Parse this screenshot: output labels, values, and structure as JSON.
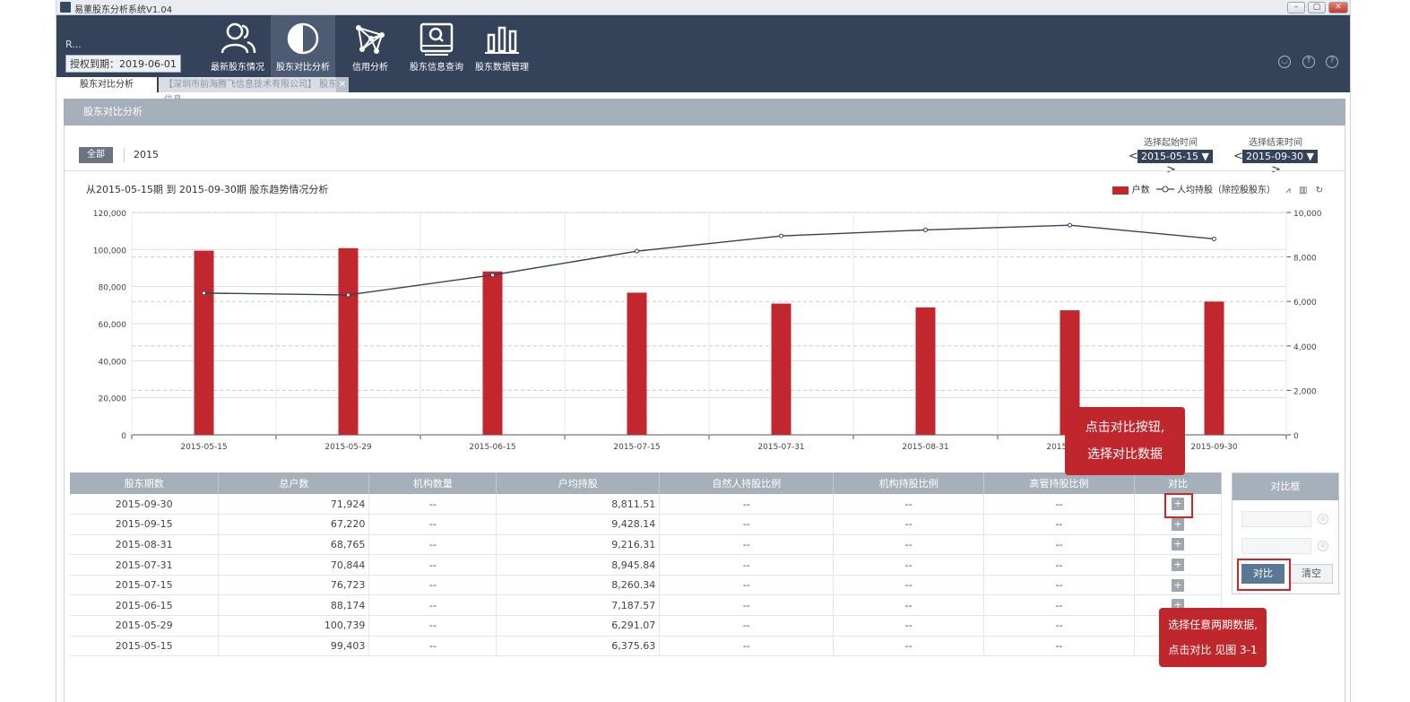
{
  "window": {
    "title": "易董股东分析系统V1.04",
    "controls": [
      "–",
      "▢",
      "✕"
    ]
  },
  "header": {
    "user": "R...",
    "auth_label": "授权到期：2019-06-01",
    "nav": [
      {
        "label": "最新股东情况",
        "icon": "users-icon"
      },
      {
        "label": "股东对比分析",
        "icon": "half-circle-icon",
        "active": true
      },
      {
        "label": "信用分析",
        "icon": "network-icon"
      },
      {
        "label": "股东信息查询",
        "icon": "search-monitor-icon"
      },
      {
        "label": "股东数据管理",
        "icon": "bar-chart-icon"
      }
    ],
    "right_icons": [
      "user-icon",
      "upload-icon",
      "help-icon"
    ]
  },
  "tabs": [
    {
      "label": "股东对比分析",
      "active": true
    },
    {
      "label": "【深圳市前海腾飞信息技术有限公司】 股东信息",
      "close": "✕"
    }
  ],
  "section_title": "股东对比分析",
  "filter": {
    "all_label": "全部",
    "year": "2015",
    "start_caption": "选择起始时间",
    "start_value": "2015-05-15",
    "end_caption": "选择结束时间",
    "end_value": "2015-09-30",
    "prev": "<",
    "next": ">",
    "dropdown": "▼"
  },
  "chart_title": "从2015-05-15期 到 2015-09-30期  股东趋势情况分析",
  "legend": {
    "bar": "户数",
    "line": "人均持股（除控股股东）"
  },
  "chart_data": {
    "type": "bar",
    "categories": [
      "2015-05-15",
      "2015-05-29",
      "2015-06-15",
      "2015-07-15",
      "2015-07-31",
      "2015-08-31",
      "2015-09-15",
      "2015-09-30"
    ],
    "series": [
      {
        "name": "户数",
        "type": "bar",
        "axis": "left",
        "color": "#c1272d",
        "values": [
          99403,
          100739,
          88174,
          76723,
          70844,
          68765,
          67220,
          71924
        ]
      },
      {
        "name": "人均持股（除控股股东）",
        "type": "line",
        "axis": "right",
        "color": "#34425a",
        "values": [
          6375.63,
          6291.07,
          7187.57,
          8260.34,
          8945.84,
          9216.31,
          9428.14,
          8811.51
        ]
      }
    ],
    "y_left": {
      "min": 0,
      "max": 120000,
      "ticks": [
        "0",
        "20,000",
        "40,000",
        "60,000",
        "80,000",
        "100,000",
        "120,000"
      ]
    },
    "y_right": {
      "min": 0,
      "max": 10000,
      "ticks": [
        "0",
        "2,000",
        "4,000",
        "6,000",
        "8,000",
        "10,000"
      ]
    },
    "grid": true
  },
  "table": {
    "headers": [
      "股东期数",
      "总户数",
      "机构数量",
      "户均持股",
      "自然人持股比例",
      "机构持股比例",
      "高管持股比例",
      "对比"
    ],
    "rows": [
      [
        "2015-09-30",
        "71,924",
        "--",
        "8,811.51",
        "--",
        "--",
        "--"
      ],
      [
        "2015-09-15",
        "67,220",
        "--",
        "9,428.14",
        "--",
        "--",
        "--"
      ],
      [
        "2015-08-31",
        "68,765",
        "--",
        "9,216.31",
        "--",
        "--",
        "--"
      ],
      [
        "2015-07-31",
        "70,844",
        "--",
        "8,945.84",
        "--",
        "--",
        "--"
      ],
      [
        "2015-07-15",
        "76,723",
        "--",
        "8,260.34",
        "--",
        "--",
        "--"
      ],
      [
        "2015-06-15",
        "88,174",
        "--",
        "7,187.57",
        "--",
        "--",
        "--"
      ],
      [
        "2015-05-29",
        "100,739",
        "--",
        "6,291.07",
        "--",
        "--",
        "--"
      ],
      [
        "2015-05-15",
        "99,403",
        "--",
        "6,375.63",
        "--",
        "--",
        "--"
      ]
    ],
    "add_symbol": "+"
  },
  "compare_box": {
    "title": "对比框",
    "compare_label": "对比",
    "clear_label": "清空",
    "remove": "⊗"
  },
  "callouts": {
    "top": [
      "点击对比按钮,",
      "选择对比数据"
    ],
    "bottom": [
      "选择任意两期数据,",
      "点击对比 见图 3-1"
    ]
  }
}
